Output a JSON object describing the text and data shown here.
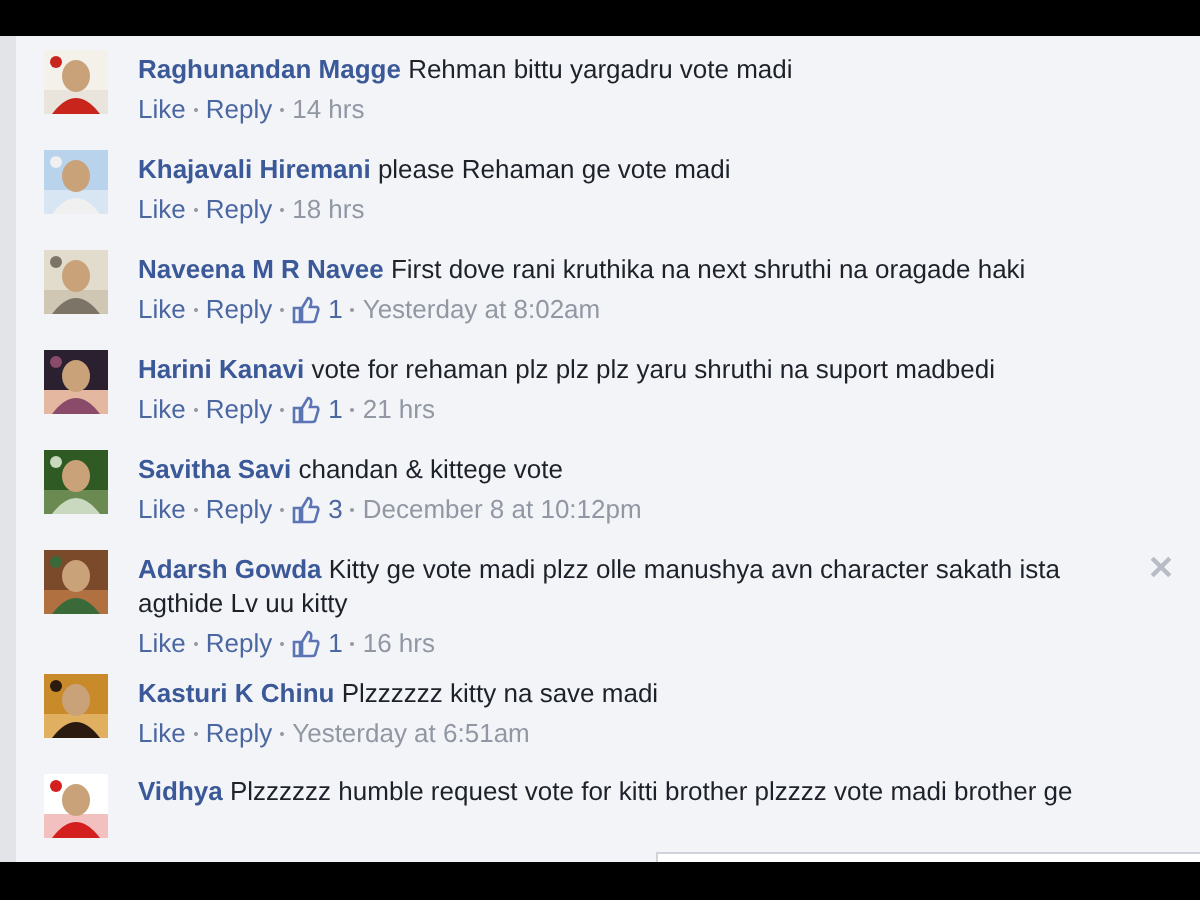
{
  "comments": [
    {
      "author": "Raghunandan Magge",
      "text": "Rehman bittu yargadru vote madi",
      "meta": {
        "like": "Like",
        "reply": "Reply",
        "time": "14 hrs"
      },
      "close_visible": false
    },
    {
      "author": "Khajavali Hiremani",
      "text": "please Rehaman ge vote madi",
      "meta": {
        "like": "Like",
        "reply": "Reply",
        "time": "18 hrs"
      },
      "close_visible": false
    },
    {
      "author": "Naveena M R Navee",
      "text": "First dove rani kruthika na next shruthi na oragade haki",
      "meta": {
        "like": "Like",
        "reply": "Reply",
        "likes": "1",
        "time": "Yesterday at 8:02am"
      },
      "close_visible": false
    },
    {
      "author": "Harini Kanavi",
      "text": "vote for rehaman plz plz plz yaru shruthi na suport madbedi",
      "meta": {
        "like": "Like",
        "reply": "Reply",
        "likes": "1",
        "time": "21 hrs"
      },
      "close_visible": false
    },
    {
      "author": "Savitha Savi",
      "text": "chandan & kittege vote",
      "meta": {
        "like": "Like",
        "reply": "Reply",
        "likes": "3",
        "time": "December 8 at 10:12pm"
      },
      "close_visible": false
    },
    {
      "author": "Adarsh Gowda",
      "text": "Kitty ge vote madi plzz olle manushya avn character sakath ista agthide Lv uu kitty",
      "meta": {
        "like": "Like",
        "reply": "Reply",
        "likes": "1",
        "time": "16 hrs"
      },
      "close_visible": true
    },
    {
      "author": "Kasturi K Chinu",
      "text": "Plzzzzzz kitty na save madi",
      "meta": {
        "like": "Like",
        "reply": "Reply",
        "time": "Yesterday at 6:51am"
      },
      "close_visible": false
    },
    {
      "author": "Vidhya",
      "text": "Plzzzzzz humble request vote for kitti brother plzzzz vote madi brother ge",
      "close_visible": false
    }
  ],
  "popup": {
    "kind": "panel"
  }
}
